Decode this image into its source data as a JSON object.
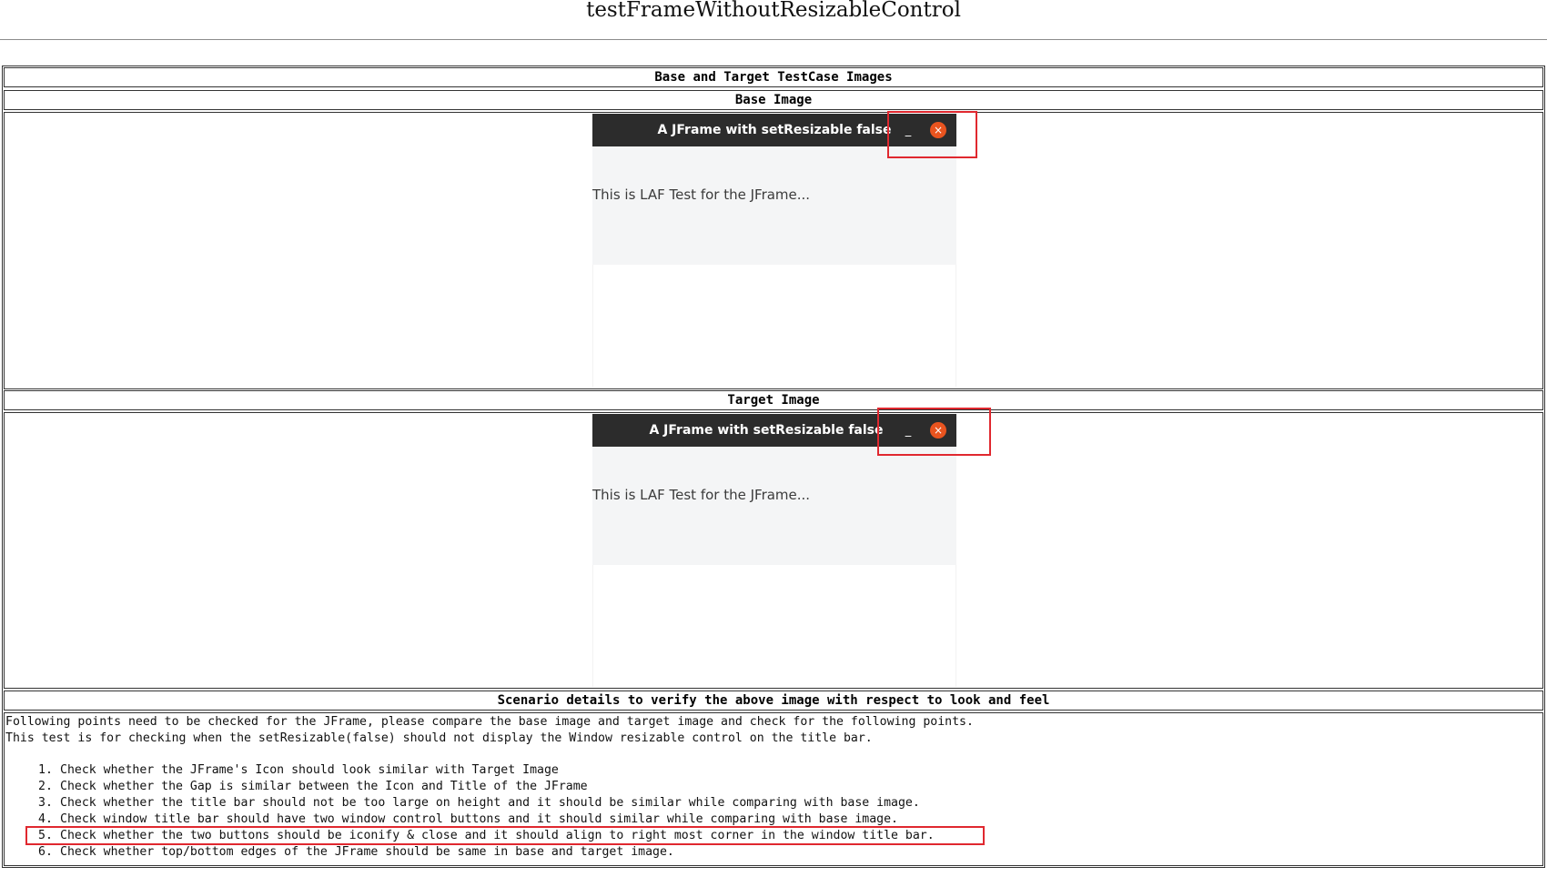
{
  "page_title": "testFrameWithoutResizableControl",
  "table": {
    "header": "Base and Target TestCase Images",
    "base_label": "Base Image",
    "target_label": "Target Image",
    "scenario_header": "Scenario details to verify the above image with respect to look and feel"
  },
  "frames": {
    "base": {
      "title": "A JFrame with setResizable false",
      "min_glyph": "_",
      "close_glyph": "×",
      "content_text": "This is LAF Test for the JFrame..."
    },
    "target": {
      "title": "A JFrame with setResizable false",
      "min_glyph": "_",
      "close_glyph": "×",
      "content_text": "This is LAF Test for the JFrame..."
    }
  },
  "scenario": {
    "intro1": "Following points need to be checked for the JFrame, please compare the base image and target image and check for the following points.",
    "intro2": "This test is for checking when the setResizable(false) should not display the Window resizable control on the title bar.",
    "points": [
      "Check whether the JFrame's Icon should look similar with Target Image",
      "Check whether the Gap is similar between the Icon and Title of the JFrame",
      "Check whether the title bar should not be too large on height and it should be similar while comparing with base image.",
      "Check window title bar should have two window control buttons and it should similar while comparing with base image.",
      "Check whether the two buttons should be iconify & close and it should align to right most corner in the window title bar.",
      "Check whether top/bottom edges of the JFrame should be same in base and target image."
    ],
    "numbers": [
      "1.",
      "2.",
      "3.",
      "4.",
      "5.",
      "6."
    ]
  },
  "colors": {
    "titlebar": "#2c2c2c",
    "close_button": "#e9541f",
    "content_bg": "#f4f5f6",
    "highlight": "#e0282f"
  }
}
